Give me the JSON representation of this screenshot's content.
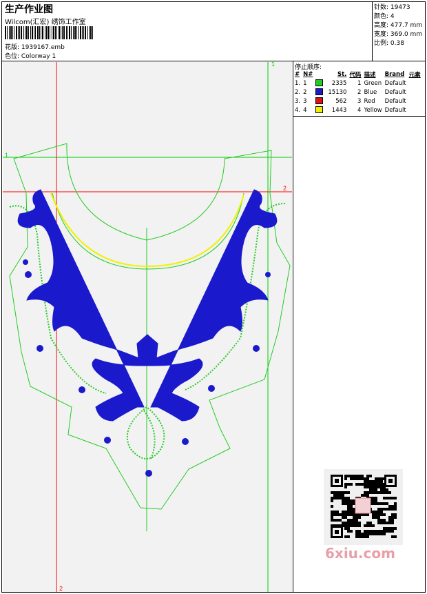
{
  "header": {
    "title": "生产作业图",
    "subtitle": "Wilcom(汇宏) 绣饰工作室",
    "design_label": "花版:",
    "design_file": "1939167.emb",
    "colorway_label": "色位:",
    "colorway": "Colorway 1"
  },
  "stats": [
    {
      "label": "针数",
      "value": "19473"
    },
    {
      "label": "颜色",
      "value": "4"
    },
    {
      "label": "高度",
      "value": "477.7 mm"
    },
    {
      "label": "宽度",
      "value": "369.0 mm"
    },
    {
      "label": "比例",
      "value": "0.38"
    }
  ],
  "stop_sequence": {
    "title": "停止顺序:",
    "columns": [
      "#",
      "N#",
      "St.",
      "代码",
      "描述",
      "Brand",
      "元素"
    ],
    "rows": [
      {
        "idx": "1.",
        "n": "1",
        "color": "#22cc22",
        "st": "2335",
        "code": "1",
        "desc": "Green",
        "brand": "Default"
      },
      {
        "idx": "2.",
        "n": "2",
        "color": "#1a1acc",
        "st": "15130",
        "code": "2",
        "desc": "Blue",
        "brand": "Default"
      },
      {
        "idx": "3.",
        "n": "3",
        "color": "#dd1111",
        "st": "562",
        "code": "3",
        "desc": "Red",
        "brand": "Default"
      },
      {
        "idx": "4.",
        "n": "4",
        "color": "#f0f000",
        "st": "1443",
        "code": "4",
        "desc": "Yellow",
        "brand": "Default"
      }
    ]
  },
  "guides": {
    "marker_1": "1",
    "marker_2": "2"
  },
  "watermark": "6xiu.com",
  "colors": {
    "guide_red": "#ff0000",
    "guide_green": "#00cc00",
    "outline_green": "#22cc22",
    "embroidery_blue": "#1a1acc",
    "yellow": "#f0f000"
  }
}
